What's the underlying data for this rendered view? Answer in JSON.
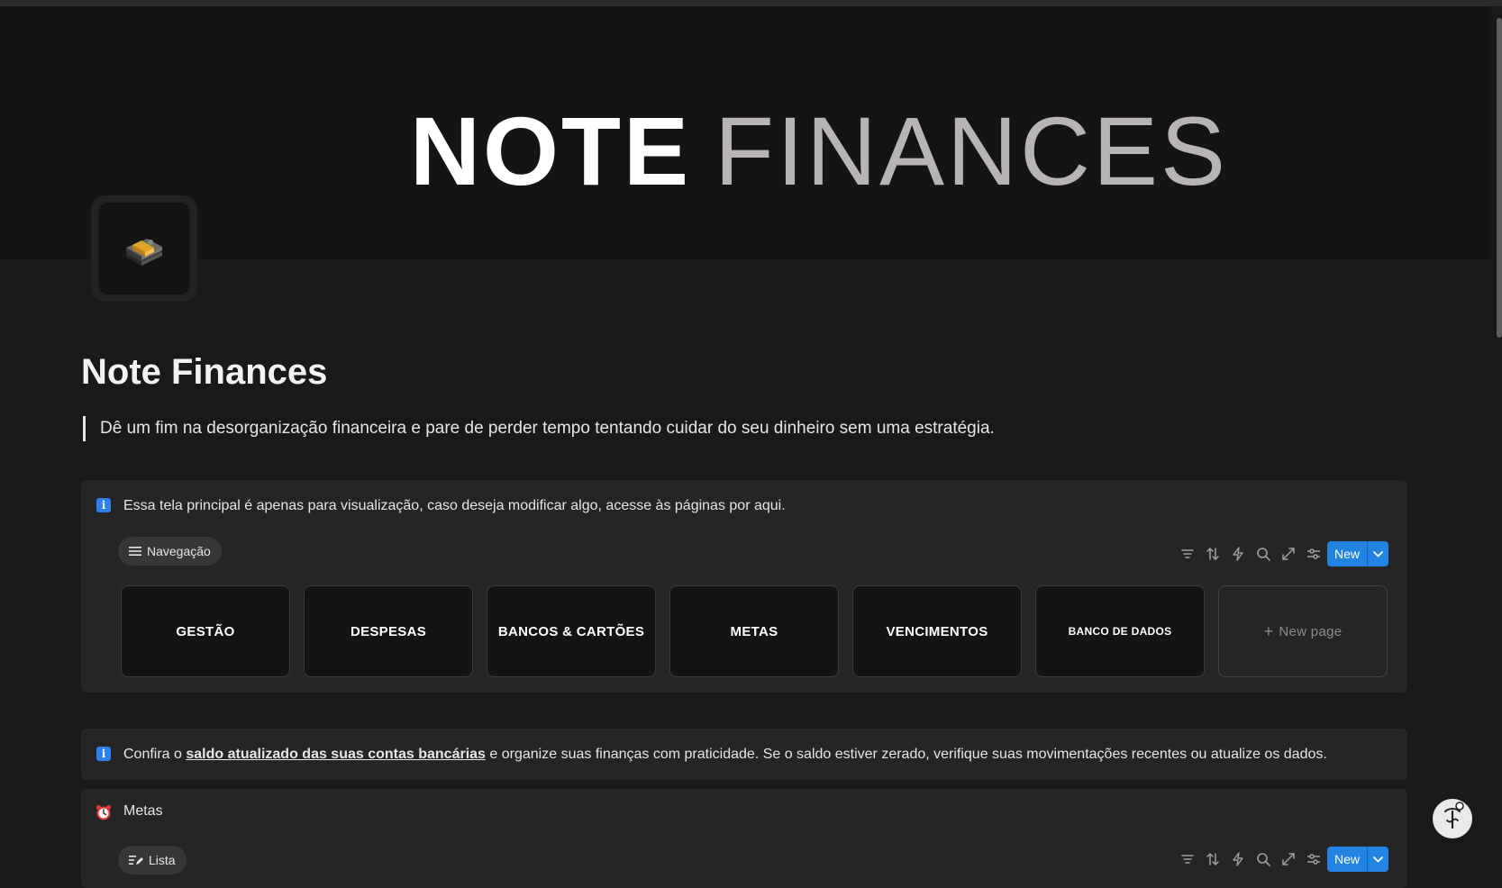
{
  "cover": {
    "title_bold": "NOTE",
    "title_light": "FINANCES"
  },
  "page": {
    "icon": "money-stack-icon",
    "title": "Note Finances",
    "quote": "Dê um fim na desorganização financeira e pare de perder tempo tentando cuidar do seu dinheiro sem uma estratégia."
  },
  "callout_nav": {
    "icon": "info-icon",
    "text": "Essa tela principal é apenas para visualização, caso deseja modificar algo, acesse às páginas por aqui.",
    "view_label": "Navegação",
    "new_label": "New",
    "cards": [
      "GESTÃO",
      "DESPESAS",
      "BANCOS & CARTÕES",
      "METAS",
      "VENCIMENTOS",
      "BANCO DE DADOS"
    ],
    "new_page_label": "New page"
  },
  "callout_balance": {
    "icon": "info-icon",
    "text_before": "Confira o",
    "link_text": "saldo atualizado das suas contas bancárias",
    "text_after": "e organize suas finanças com praticidade. Se o saldo estiver zerado, verifique suas movimentações recentes ou atualize os dados."
  },
  "metas": {
    "icon": "alarm-clock-icon",
    "title": "Metas",
    "view_label": "Lista",
    "new_label": "New"
  },
  "colors": {
    "accent": "#2383e2",
    "background": "#191919",
    "callout": "#252525"
  }
}
